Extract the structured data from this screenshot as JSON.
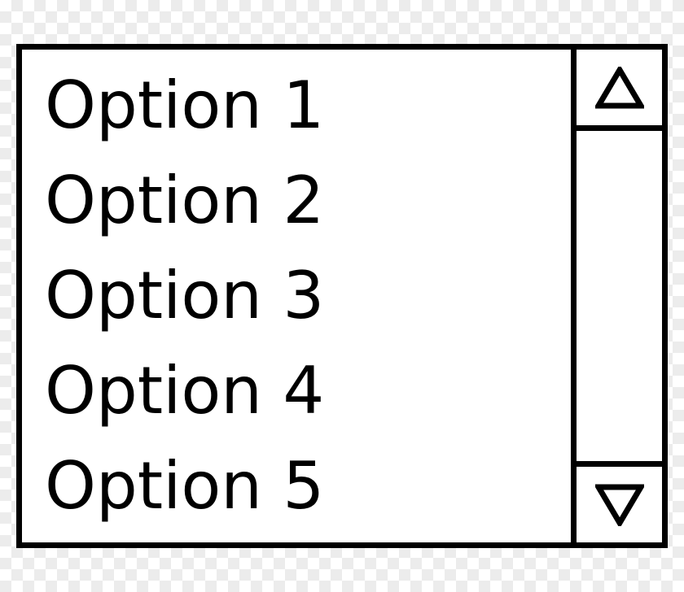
{
  "listbox": {
    "options": [
      {
        "label": "Option 1"
      },
      {
        "label": "Option 2"
      },
      {
        "label": "Option 3"
      },
      {
        "label": "Option 4"
      },
      {
        "label": "Option 5"
      }
    ]
  }
}
